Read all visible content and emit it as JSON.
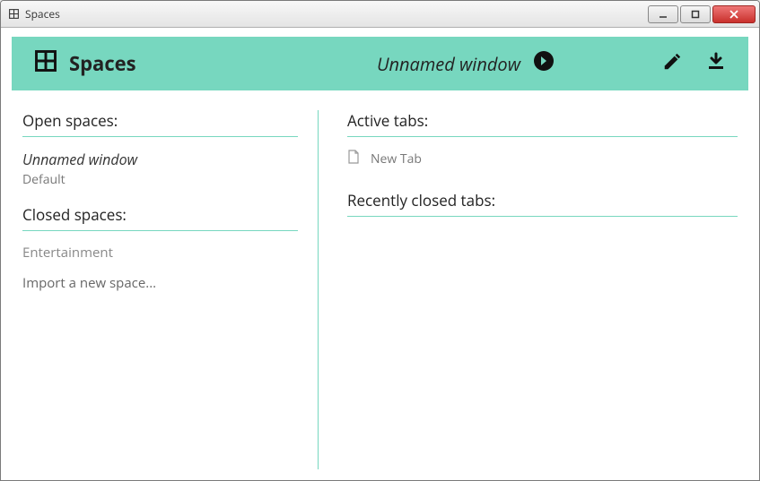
{
  "window": {
    "title": "Spaces"
  },
  "header": {
    "app_name": "Spaces",
    "current_window": "Unnamed window"
  },
  "left": {
    "open_title": "Open spaces:",
    "open_spaces": [
      {
        "name": "Unnamed window",
        "sub": "Default"
      }
    ],
    "closed_title": "Closed spaces:",
    "closed_spaces": [
      {
        "name": "Entertainment"
      }
    ],
    "import_label": "Import a new space..."
  },
  "right": {
    "active_title": "Active tabs:",
    "active_tabs": [
      {
        "title": "New Tab"
      }
    ],
    "recent_title": "Recently closed tabs:"
  }
}
